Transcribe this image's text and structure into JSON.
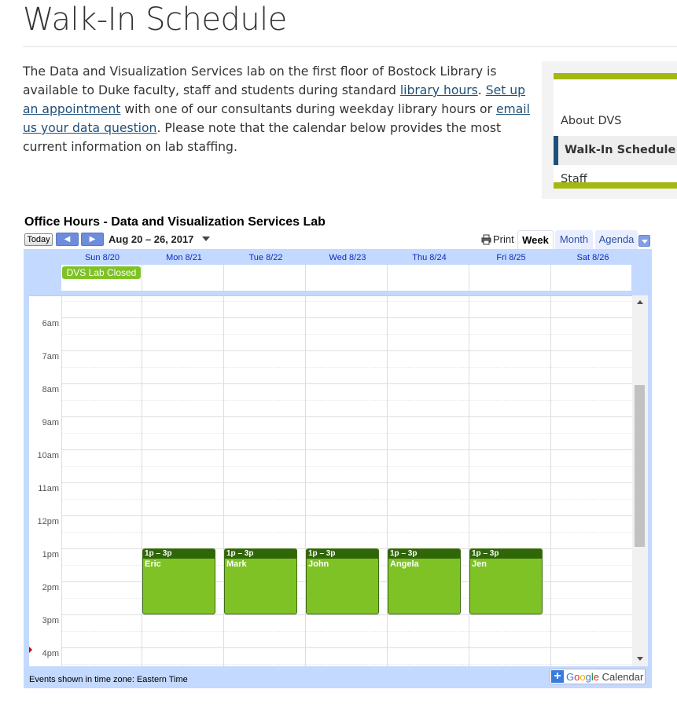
{
  "page": {
    "title": "Walk-In Schedule"
  },
  "intro": {
    "t1": "The Data and Visualization Services lab on the first floor of Bostock Library is available to Duke faculty, staff and students during standard ",
    "link1": "library hours",
    "t2": ". ",
    "link2": "Set up an appointment",
    "t3": " with one of our consultants during weekday library hours or ",
    "link3": "email us your data question",
    "t4": ". Please note that the calendar below provides the most current information on lab staffing."
  },
  "sidenav": {
    "items": [
      {
        "label": "About DVS"
      },
      {
        "label": "Walk-In Schedule"
      },
      {
        "label": "Staff"
      }
    ]
  },
  "calendar": {
    "title": "Office Hours - Data and Visualization Services Lab",
    "today_label": "Today",
    "prev_label": "◀",
    "next_label": "▶",
    "date_range": "Aug 20 – 26, 2017",
    "print_label": "Print",
    "tabs": [
      "Week",
      "Month",
      "Agenda"
    ],
    "days": [
      "Sun 8/20",
      "Mon 8/21",
      "Tue 8/22",
      "Wed 8/23",
      "Thu 8/24",
      "Fri 8/25",
      "Sat 8/26"
    ],
    "allday_event": "DVS Lab Closed",
    "hours": [
      "6am",
      "7am",
      "8am",
      "9am",
      "10am",
      "11am",
      "12pm",
      "1pm",
      "2pm",
      "3pm",
      "4pm"
    ],
    "events": [
      {
        "time": "1p – 3p",
        "name": "Eric"
      },
      {
        "time": "1p – 3p",
        "name": "Mark"
      },
      {
        "time": "1p – 3p",
        "name": "John"
      },
      {
        "time": "1p – 3p",
        "name": "Angela"
      },
      {
        "time": "1p – 3p",
        "name": "Jen"
      }
    ],
    "timezone_note": "Events shown in time zone: Eastern Time",
    "badge": {
      "plus": "+",
      "g": "G",
      "o1": "o",
      "o2": "o",
      "g2": "g",
      "l": "l",
      "e": "e",
      "rest": " Calendar"
    },
    "event_color": "#7ec225",
    "event_header_color": "#2f6608"
  }
}
